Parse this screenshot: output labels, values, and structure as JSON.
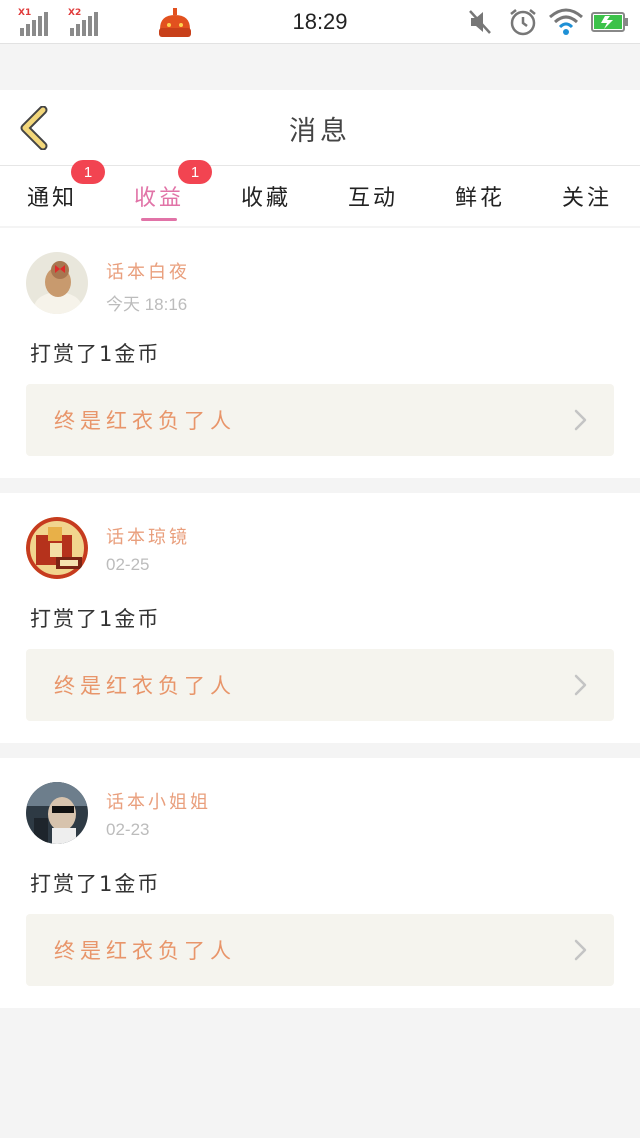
{
  "status_bar": {
    "sim1_label": "X1",
    "sim2_label": "X2",
    "time": "18:29"
  },
  "header": {
    "title": "消息",
    "back_icon": "chevron-left-icon"
  },
  "tabs": [
    {
      "label": "通知",
      "badge": "1",
      "active": false
    },
    {
      "label": "收益",
      "badge": "1",
      "active": true
    },
    {
      "label": "收藏",
      "badge": "",
      "active": false
    },
    {
      "label": "互动",
      "badge": "",
      "active": false
    },
    {
      "label": "鲜花",
      "badge": "",
      "active": false
    },
    {
      "label": "关注",
      "badge": "",
      "active": false
    }
  ],
  "messages": [
    {
      "username": "话本白夜",
      "time": "今天 18:16",
      "text": "打赏了1金币",
      "reference": "终是红衣负了人"
    },
    {
      "username": "话本琼镜",
      "time": "02-25",
      "text": "打赏了1金币",
      "reference": "终是红衣负了人"
    },
    {
      "username": "话本小姐姐",
      "time": "02-23",
      "text": "打赏了1金币",
      "reference": "终是红衣负了人"
    }
  ],
  "colors": {
    "accent": "#e173a7",
    "badge": "#f24451",
    "username": "#e99f7d",
    "reference_text": "#e8956a",
    "reference_bg": "#f5f4ee",
    "back_icon": "#f3d77a"
  }
}
